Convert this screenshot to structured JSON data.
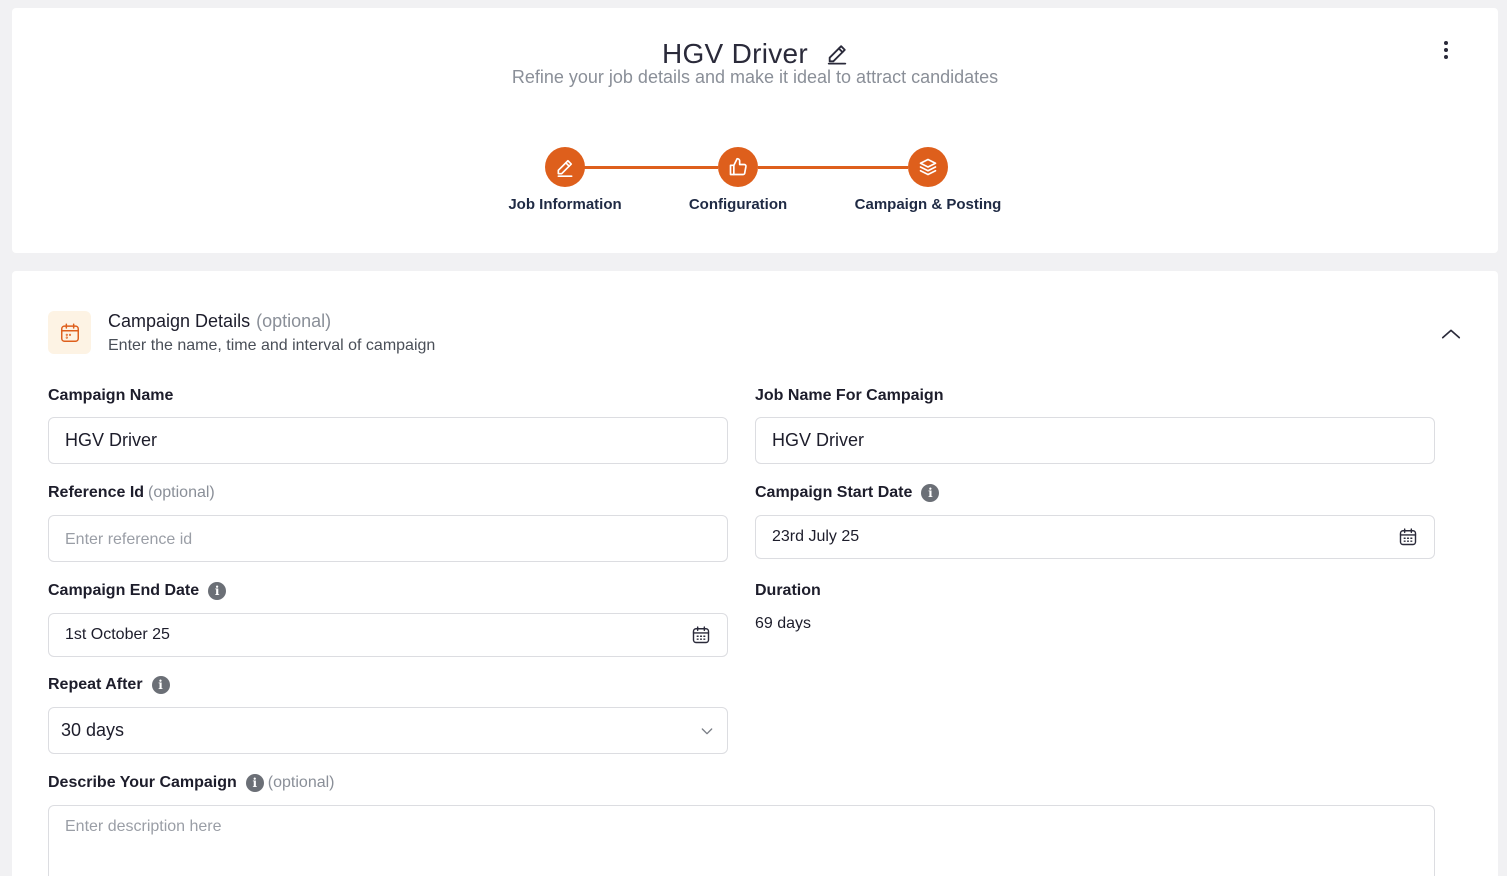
{
  "header": {
    "job_title": "HGV Driver",
    "subtitle": "Refine your job details and make it ideal to attract candidates",
    "accent_color": "#de5f1c"
  },
  "stepper": {
    "steps": [
      {
        "label": "Job Information",
        "icon": "pencil-icon"
      },
      {
        "label": "Configuration",
        "icon": "thumbs-up-icon"
      },
      {
        "label": "Campaign & Posting",
        "icon": "layers-icon"
      }
    ]
  },
  "section": {
    "title": "Campaign Details",
    "optional": "(optional)",
    "description": "Enter the name, time and interval of campaign",
    "icon": "calendar-icon"
  },
  "form": {
    "campaign_name": {
      "label": "Campaign Name",
      "value": "HGV Driver"
    },
    "job_name": {
      "label": "Job Name For Campaign",
      "value": "HGV Driver"
    },
    "reference_id": {
      "label": "Reference Id",
      "optional": "(optional)",
      "placeholder": "Enter reference id",
      "value": ""
    },
    "start_date": {
      "label": "Campaign Start Date",
      "value": "23rd July 25"
    },
    "end_date": {
      "label": "Campaign End Date",
      "value": "1st October 25"
    },
    "duration": {
      "label": "Duration",
      "value": "69 days"
    },
    "repeat_after": {
      "label": "Repeat After",
      "value": "30 days"
    },
    "description": {
      "label": "Describe Your Campaign",
      "optional": "(optional)",
      "placeholder": "Enter description here"
    }
  }
}
